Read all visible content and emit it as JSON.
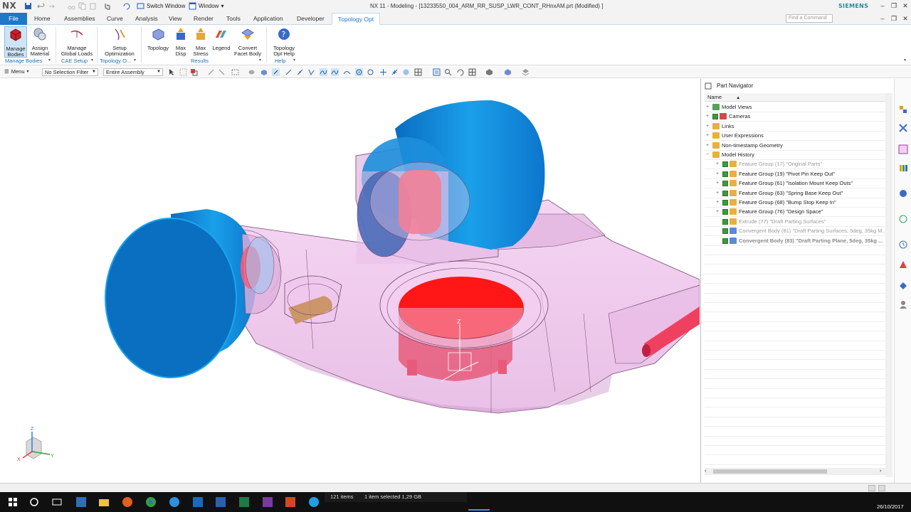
{
  "titlebar": {
    "logo": "NX",
    "switch_window": "Switch Window",
    "window_menu": "Window",
    "title": "NX 11 - Modeling - [13233550_004_ARM_RR_SUSP_LWR_CONT_RHnxAM.prt (Modified) ]",
    "brand": "SIEMENS"
  },
  "tabs": {
    "file": "File",
    "items": [
      "Home",
      "Assemblies",
      "Curve",
      "Analysis",
      "View",
      "Render",
      "Tools",
      "Application",
      "Developer"
    ],
    "active": "Topology Opt",
    "find_command": "Find a Command"
  },
  "ribbon": {
    "buttons": [
      {
        "label1": "Manage",
        "label2": "Bodies"
      },
      {
        "label1": "Assign",
        "label2": "Material"
      },
      {
        "label1": "Manage",
        "label2": "Global Loads"
      },
      {
        "label1": "Setup",
        "label2": "Optimization"
      },
      {
        "label1": "Topology",
        "label2": ""
      },
      {
        "label1": "Max",
        "label2": "Disp"
      },
      {
        "label1": "Max",
        "label2": "Stress"
      },
      {
        "label1": "Legend",
        "label2": ""
      },
      {
        "label1": "Convert",
        "label2": "Facet Body"
      },
      {
        "label1": "Topology",
        "label2": "Opt Help"
      }
    ],
    "groups": [
      "Manage Bodies",
      "CAE Setup",
      "Topology O...",
      "Results",
      "Help"
    ]
  },
  "selbar": {
    "menu": "Menu",
    "filter": "No Selection Filter",
    "scope": "Entire Assembly"
  },
  "navigator": {
    "title": "Part Navigator",
    "column": "Name",
    "rows": [
      {
        "label": "Model Views",
        "style": "normal",
        "indent": 0
      },
      {
        "label": "Cameras",
        "style": "normal",
        "indent": 0
      },
      {
        "label": "Links",
        "style": "normal",
        "indent": 0
      },
      {
        "label": "User Expressions",
        "style": "normal",
        "indent": 0
      },
      {
        "label": "Non-timestamp Geometry",
        "style": "normal",
        "indent": 0
      },
      {
        "label": "Model History",
        "style": "normal",
        "indent": 0
      },
      {
        "label": "Feature Group (17) \"Original Parts\"",
        "style": "gray",
        "indent": 1
      },
      {
        "label": "Feature Group (19) \"Pivot Pin Keep Out\"",
        "style": "normal",
        "indent": 1
      },
      {
        "label": "Feature Group (61) \"Isolation Mount Keep Outs\"",
        "style": "normal",
        "indent": 1
      },
      {
        "label": "Feature Group (63) \"Spring Base Keep Out\"",
        "style": "normal",
        "indent": 1
      },
      {
        "label": "Feature Group (68) \"Bump Stop Keep In\"",
        "style": "normal",
        "indent": 1
      },
      {
        "label": "Feature Group (76) \"Design Space\"",
        "style": "normal",
        "indent": 1
      },
      {
        "label": "Extrude (77) \"Draft Parting Surfaces\"",
        "style": "gray",
        "indent": 1
      },
      {
        "label": "Convergent Body (81) \"Draft Parting Surfaces, 5deg, 35kg M...",
        "style": "gray",
        "indent": 1
      },
      {
        "label": "Convergent Body (83) \"Draft Parting Plane, 5deg, 35kg ...",
        "style": "boldgray",
        "indent": 1
      }
    ]
  },
  "taskbar": {
    "items_count": "121 items",
    "selected": "1 item selected  1,29 GB",
    "date": "26/10/2017"
  },
  "colors": {
    "accent": "#1f77c8",
    "body_pink": "#e7b5e3",
    "cyl_blue": "#1a9ae0",
    "red": "#ff1a1a"
  }
}
